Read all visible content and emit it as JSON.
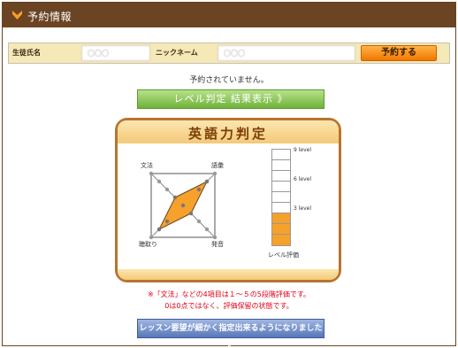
{
  "header": {
    "title": "予約情報",
    "icon": "chevron-down-icon"
  },
  "info_row": {
    "student_name_label": "生徒氏名",
    "student_name_value": "〇〇〇",
    "nickname_label": "ニックネーム",
    "nickname_value": "〇〇〇",
    "reserve_button": "予約する"
  },
  "notice": "予約されていません。",
  "result_button": "レベル判定 結果表示 》",
  "panel": {
    "title": "英語力判定",
    "radar": {
      "labels": {
        "top_left": "文法",
        "top_right": "語彙",
        "bottom_left": "聴取り",
        "bottom_right": "発音"
      }
    },
    "meter": {
      "ticks": [
        "9 level",
        "6 level",
        "3 level"
      ],
      "caption": "レベル評価",
      "level_fraction": 0.33
    }
  },
  "notes": {
    "line1": "※「文法」などの4項目は１〜５の5段階評価です。",
    "line2": "0は0点ではなく、評価保留の状態です。"
  },
  "lesson_button": "レッスン要望が細かく指定出来るようになりました 》",
  "colors": {
    "brown": "#6b4423",
    "orange": "#f5a12b",
    "green": "#6fb23a",
    "blue": "#5877b8",
    "red": "#e0001b"
  }
}
